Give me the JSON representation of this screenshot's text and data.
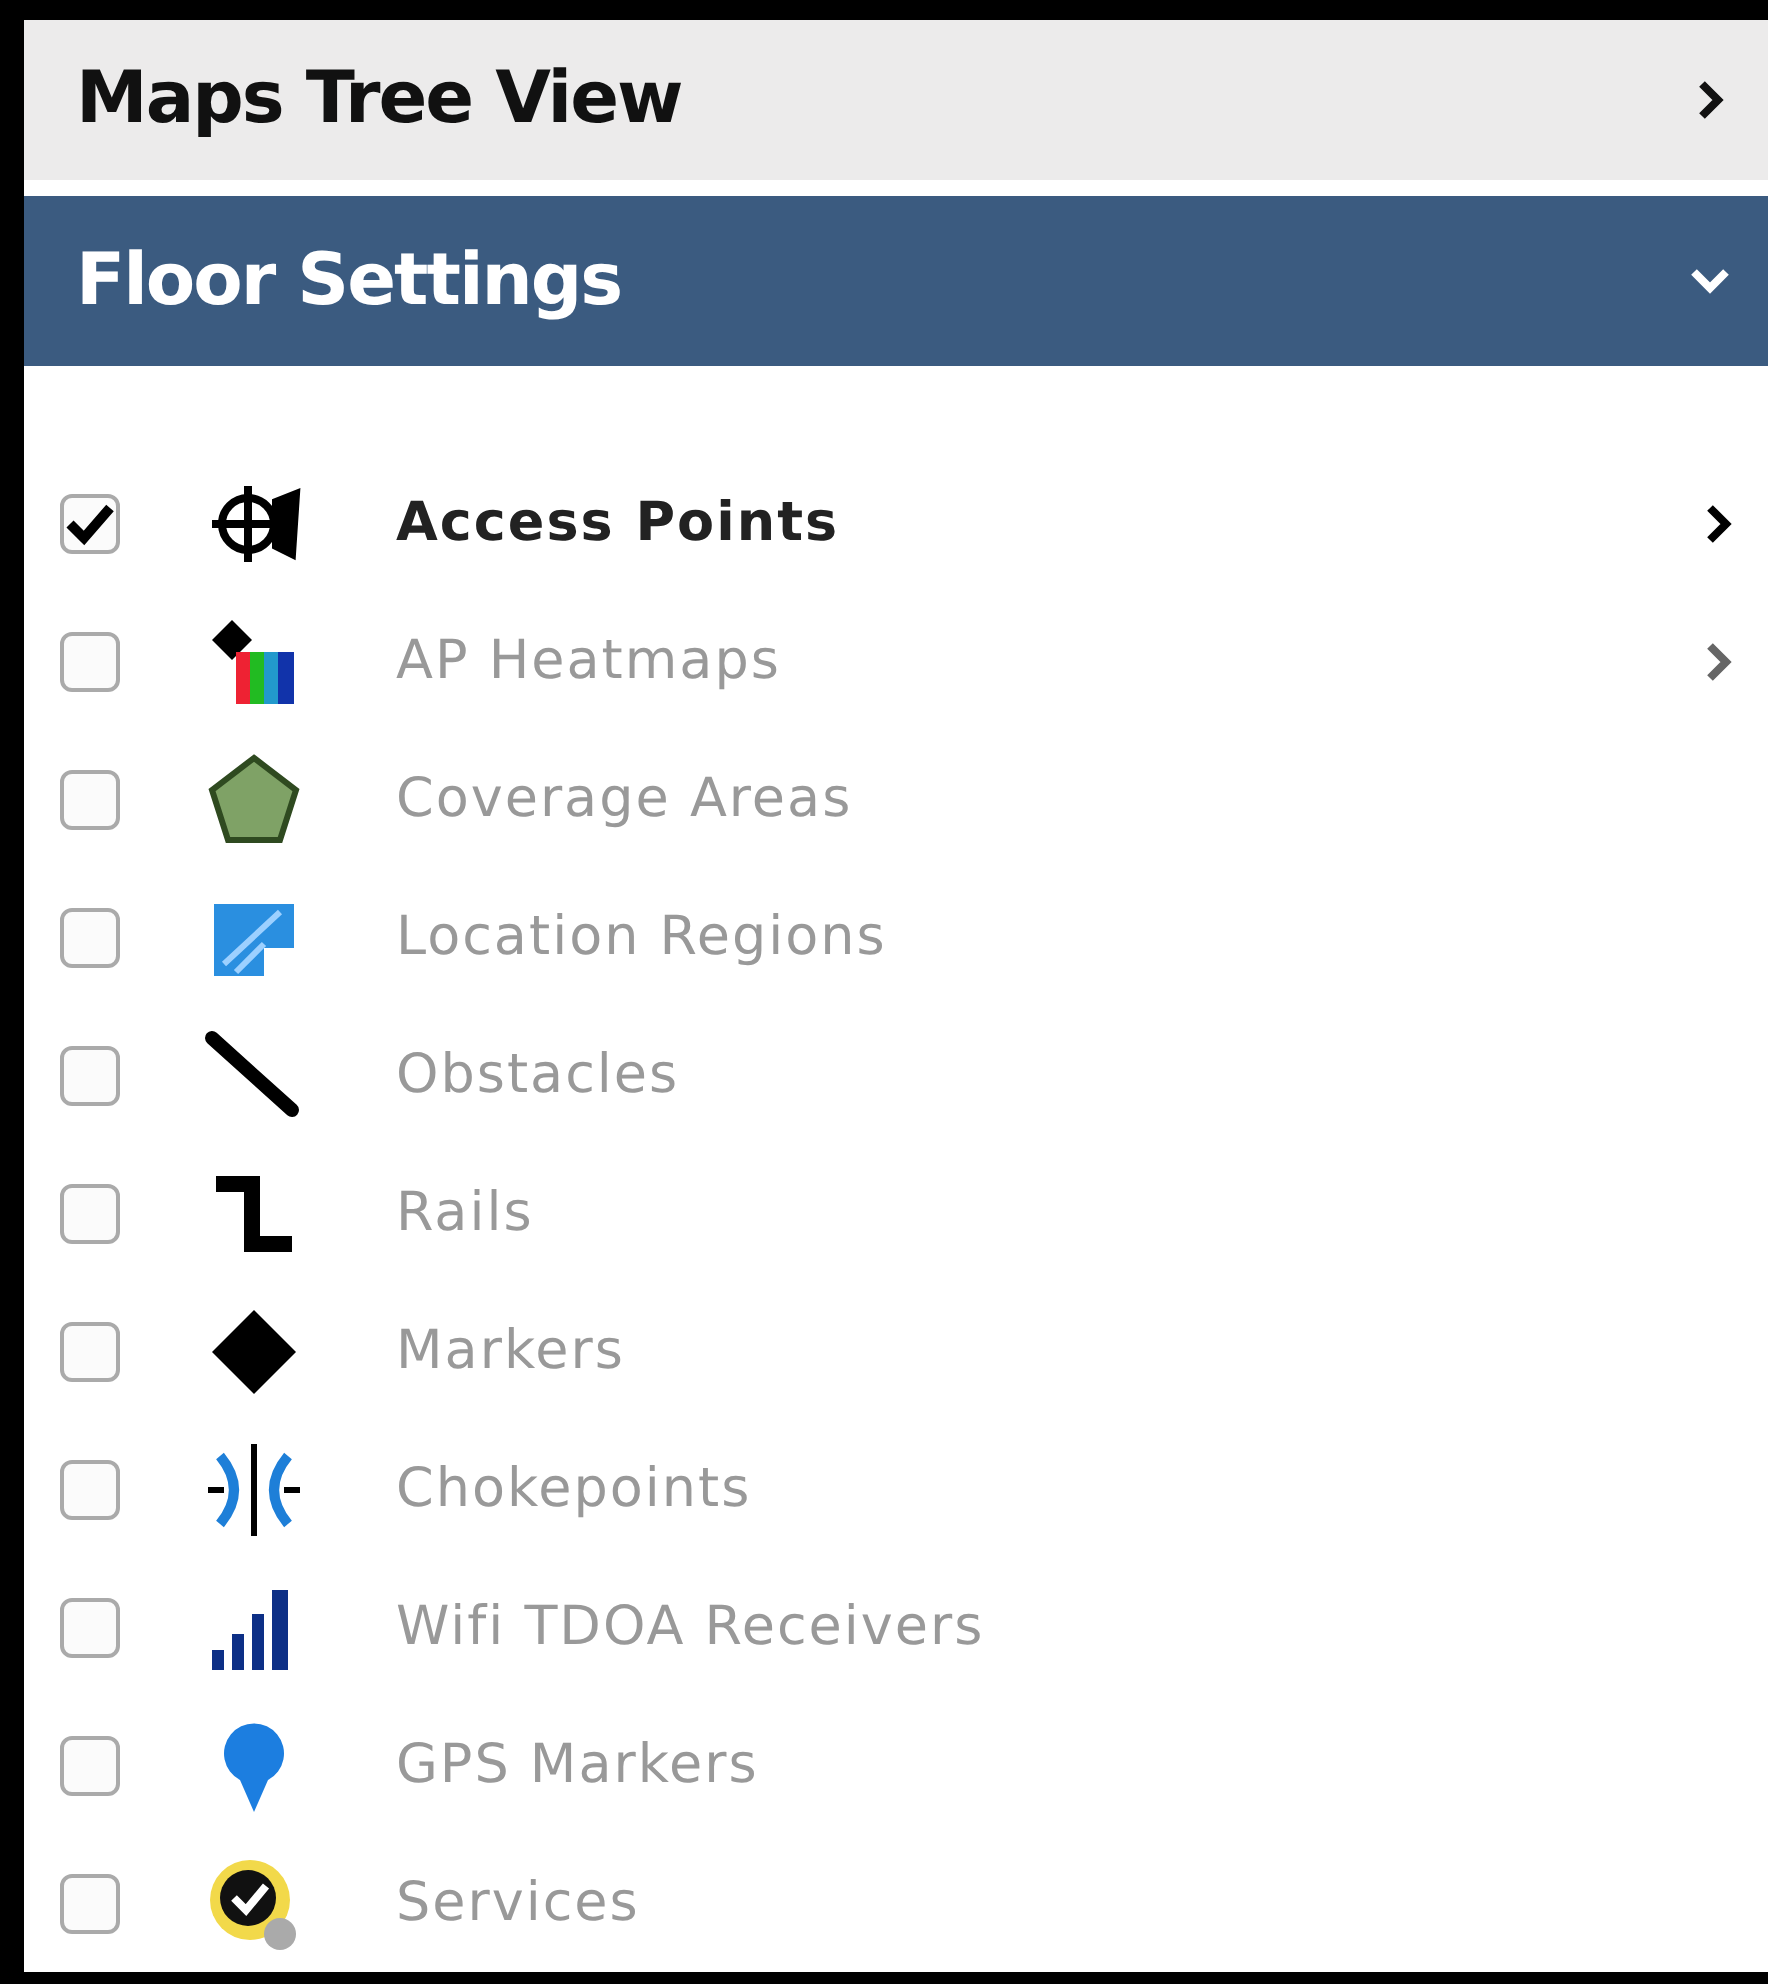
{
  "sections": [
    {
      "title": "Maps Tree View",
      "expanded": false
    },
    {
      "title": "Floor Settings",
      "expanded": true
    }
  ],
  "layers": [
    {
      "label": "Access Points",
      "kind": "access-point",
      "checked": true,
      "submenu": true
    },
    {
      "label": "AP Heatmaps",
      "kind": "heatmap",
      "checked": false,
      "submenu": true
    },
    {
      "label": "Coverage Areas",
      "kind": "coverage",
      "checked": false,
      "submenu": false
    },
    {
      "label": "Location Regions",
      "kind": "region",
      "checked": false,
      "submenu": false
    },
    {
      "label": "Obstacles",
      "kind": "obstacle",
      "checked": false,
      "submenu": false
    },
    {
      "label": "Rails",
      "kind": "rail",
      "checked": false,
      "submenu": false
    },
    {
      "label": "Markers",
      "kind": "marker",
      "checked": false,
      "submenu": false
    },
    {
      "label": "Chokepoints",
      "kind": "chokepoint",
      "checked": false,
      "submenu": false
    },
    {
      "label": "Wifi TDOA Receivers",
      "kind": "receiver",
      "checked": false,
      "submenu": false
    },
    {
      "label": "GPS Markers",
      "kind": "gps",
      "checked": false,
      "submenu": false
    },
    {
      "label": "Services",
      "kind": "service",
      "checked": false,
      "submenu": false
    }
  ]
}
